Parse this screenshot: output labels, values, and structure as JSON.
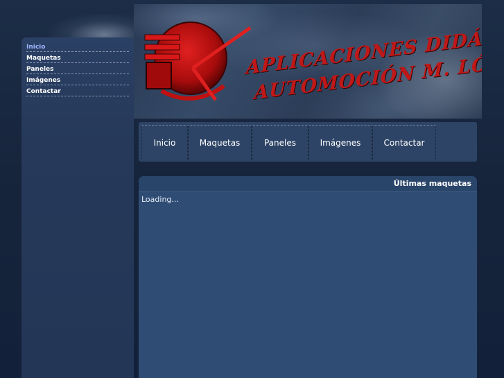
{
  "sidebar": {
    "items": [
      {
        "label": "Inicio",
        "active": true
      },
      {
        "label": "Maquetas",
        "active": false
      },
      {
        "label": "Paneles",
        "active": false
      },
      {
        "label": "Imágenes",
        "active": false
      },
      {
        "label": "Contactar",
        "active": false
      }
    ]
  },
  "banner": {
    "title_line1": "APLICACIONES DIDÁCTICAS",
    "title_line2": "AUTOMOCIÓN M. LÓPEZ",
    "logo_icon": "red-circle-logo-icon",
    "colors": {
      "title": "#c01818",
      "logo": "#b81010"
    }
  },
  "topnav": {
    "items": [
      {
        "label": "Inicio"
      },
      {
        "label": "Maquetas"
      },
      {
        "label": "Paneles"
      },
      {
        "label": "Imágenes"
      },
      {
        "label": "Contactar"
      }
    ]
  },
  "content": {
    "heading": "Últimas maquetas",
    "status": "Loading..."
  },
  "colors": {
    "background": "#1c2d47",
    "panel": "#2f4d74",
    "active_link": "#9fb6ff"
  }
}
